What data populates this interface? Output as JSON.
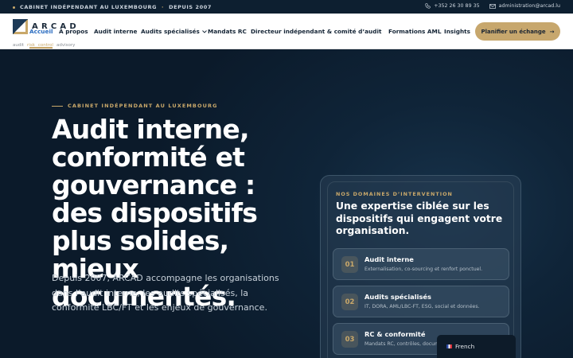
{
  "topbar": {
    "left_text": "CABINET INDÉPENDANT AU LUXEMBOURG",
    "left_sep": "·",
    "left_since": "DEPUIS 2007",
    "phone": "+352 26 30 89 35",
    "email": "administration@arcad.lu"
  },
  "logo": {
    "wordmark": "ARCAD",
    "tags": [
      "audit",
      "risk",
      "control",
      "advisory"
    ]
  },
  "nav": {
    "items": [
      {
        "label": "Accueil"
      },
      {
        "label": "À propos"
      },
      {
        "label": "Audit interne"
      },
      {
        "label": "Audits spécialisés"
      },
      {
        "label": "Mandats RC"
      },
      {
        "label": "Directeur indépendant & comité d’audit"
      },
      {
        "label": "Formations AML"
      },
      {
        "label": "Insights"
      }
    ],
    "cta_label": "Planifier un échange",
    "cta_arrow": "→"
  },
  "hero": {
    "eyebrow": "CABINET INDÉPENDANT AU LUXEMBOURG",
    "headline": "Audit interne, conformité et gouvernance : des dispositifs plus solides, mieux documentés.",
    "lead": "Depuis 2007, ARCAD accompagne les organisations dans l’audit interne, les audits spécialisés, la conformité LBC/FT et les enjeux de gouvernance."
  },
  "domains": {
    "label": "NOS DOMAINES D’INTERVENTION",
    "title": "Une expertise ciblée sur les dispositifs qui engagent votre organisation.",
    "items": [
      {
        "num": "01",
        "title": "Audit interne",
        "desc": "Externalisation, co-sourcing et renfort ponctuel."
      },
      {
        "num": "02",
        "title": "Audits spécialisés",
        "desc": "IT, DORA, AML/LBC-FT, ESG, social et données."
      },
      {
        "num": "03",
        "title": "RC & conformité",
        "desc": "Mandats RC, contrôles, documentation"
      }
    ]
  },
  "language": {
    "label": "French"
  },
  "colors": {
    "accent": "#c9a86a",
    "navy": "#0b1a2a",
    "link_active": "#2a6cc0"
  }
}
